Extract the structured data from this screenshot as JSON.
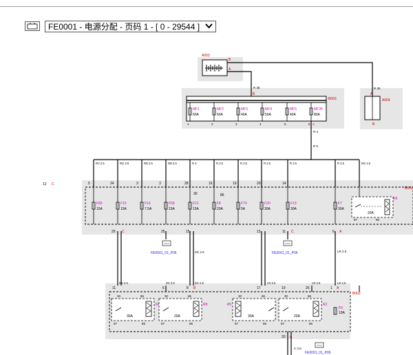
{
  "toolbar": {
    "page_title": "FE0001 - 电源分配 - 页码 1 - [ 0 - 29544 ]",
    "connector_icon": "connector-icon",
    "dropdown_icon": "chevron-down-icon"
  },
  "colors": {
    "component_label": "#cc00cc",
    "connector_code": "#cc0000",
    "link": "#1a1aff",
    "box_fill": "#e6e6e6"
  },
  "battery": {
    "id": "A003",
    "pin_a": "A",
    "pin_b": "B"
  },
  "generator": {
    "id": "A004",
    "wire": "R 35",
    "pin_a": "A",
    "pin_b": "B"
  },
  "b003": {
    "id": "B003",
    "wire_in": "R 35",
    "pin_in": "B",
    "fuses": [
      {
        "id": "MF1",
        "rating": "60A",
        "pin": "1"
      },
      {
        "id": "MF2",
        "rating": "60A",
        "pin": "2"
      },
      {
        "id": "MF3",
        "rating": "40A",
        "pin": "3"
      },
      {
        "id": "MF4",
        "rating": "50A",
        "pin": "4"
      },
      {
        "id": "MF5",
        "rating": "40A",
        "pin": "5"
      },
      {
        "id": "MF35",
        "rating": "80A",
        "pin": "6",
        "pin_code": "A"
      }
    ],
    "wire_out_1": "R 4",
    "wire_out_2": "R 6"
  },
  "row_label": {
    "num": "12",
    "code": "C"
  },
  "b001": {
    "id": "B001",
    "top_wires": [
      "RV 2.5",
      "RG 2.5",
      "RB 2.5",
      "RB 2.5",
      "R 4",
      "R 2.5",
      "R 2.5",
      "R 2.5",
      "R 2.5",
      "R 2.5",
      "RG 2.5"
    ],
    "top_pins": [
      "5",
      "24",
      "3",
      "3",
      "28",
      "16",
      "19",
      "20",
      "14",
      "26"
    ],
    "inner_nums": [
      "30",
      "86"
    ],
    "fuses": [
      {
        "id": "F85",
        "rating": "15A"
      },
      {
        "id": "F15",
        "rating": "15A"
      },
      {
        "id": "F16",
        "rating": "7.5A"
      },
      {
        "id": "F58",
        "rating": "15A"
      },
      {
        "id": "F21",
        "rating": "15A"
      },
      {
        "id": "F8",
        "rating": "20A"
      },
      {
        "id": "F79",
        "rating": "5A"
      },
      {
        "id": "F20",
        "rating": "30A"
      },
      {
        "id": "F19",
        "rating": "30A"
      },
      {
        "id": "F7",
        "rating": "30A"
      }
    ],
    "relay": {
      "id": "R6",
      "rating": "20A",
      "pin_87": "87",
      "pin_85": "85"
    },
    "bottom_pins": [
      "29",
      "25",
      "15",
      "13",
      "11",
      "6"
    ],
    "bottom_codes": [
      "C",
      "A"
    ]
  },
  "links": [
    {
      "text": "FE0001_01_P06"
    },
    {
      "text": "FE0001_01_P06"
    },
    {
      "text": "FE0001_01_P06"
    }
  ],
  "mid_wires": [
    "ZG 2.5",
    "LR 2.5"
  ],
  "b002": {
    "id": "B002",
    "top_wires": [
      "RS 2.5",
      "ZG 2.5",
      "ZG 2.5",
      "LR 2.5",
      "LR 2.5",
      "LR 2.5"
    ],
    "top_pins": [
      "11",
      "6",
      "8",
      "17",
      "19",
      "26",
      "1"
    ],
    "top_codes": [
      "B",
      "A"
    ],
    "relays": [
      {
        "id": "R4",
        "rating": "30A",
        "p30": "30",
        "p86": "86",
        "p87": "87",
        "p85": "85"
      },
      {
        "id": "R8",
        "rating": "20A",
        "p30": "30",
        "p86": "86",
        "p87": "87",
        "p85": "85"
      },
      {
        "id": "R5",
        "rating": "30A",
        "p30": "30",
        "p86": "86",
        "p87": "87",
        "p85": "85"
      },
      {
        "id": "R2",
        "rating": "20A",
        "p30": "30",
        "p86": "86",
        "p87": "87",
        "p85": "85"
      }
    ],
    "fuse": {
      "id": "F9",
      "rating": "10A"
    },
    "bottom_pin": "20",
    "bottom_code": "A",
    "bottom_wire": "C 2.5"
  }
}
